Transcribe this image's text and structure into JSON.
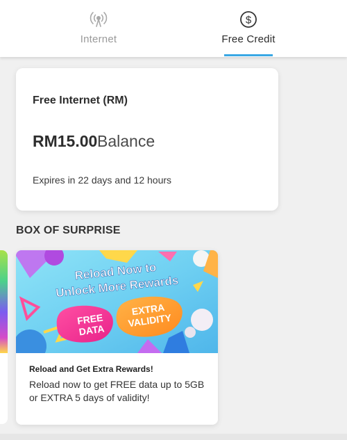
{
  "tabs": {
    "internet": {
      "label": "Internet",
      "icon": "signal-tower-icon",
      "active": false
    },
    "free_credit": {
      "label": "Free Credit",
      "icon": "dollar-circle-icon",
      "active": true
    }
  },
  "balance_card": {
    "title": "Free Internet (RM)",
    "amount": "RM15.00",
    "amount_suffix": "Balance",
    "expiry": "Expires in 22 days and 12 hours"
  },
  "section": {
    "title": "BOX OF SURPRISE"
  },
  "promo": {
    "banner": {
      "headline_line1": "Reload Now to",
      "headline_line2": "Unlock More Rewards",
      "badge1_line1": "FREE",
      "badge1_line2": "DATA",
      "badge2_line1": "EXTRA",
      "badge2_line2": "VALIDITY"
    },
    "title": "Reload and Get Extra Rewards!",
    "description": "Reload now to get FREE data up to 5GB or EXTRA 5 days of validity!"
  },
  "colors": {
    "accent": "#3aa7e4",
    "tab_inactive": "#9a9a9a",
    "text_dark": "#2d2d2d"
  }
}
